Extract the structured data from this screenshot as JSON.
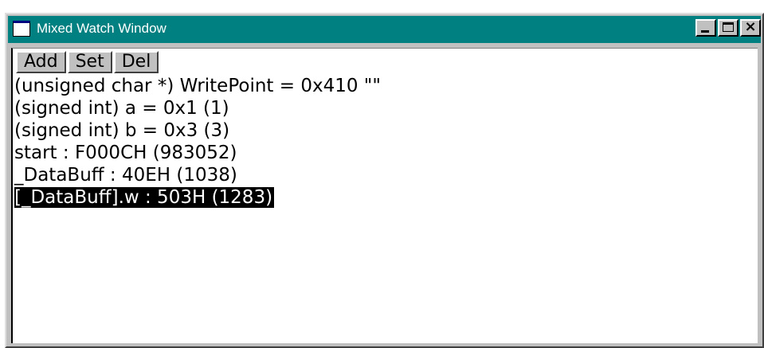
{
  "window": {
    "title": "Mixed Watch Window",
    "title_icon": "app-window-icon",
    "controls": {
      "minimize_icon": "minimize-icon",
      "maximize_icon": "maximize-icon",
      "close_icon": "close-icon",
      "close_glyph": "×"
    },
    "titlebar_color": "#008080"
  },
  "toolbar": {
    "add_label": "Add",
    "set_label": "Set",
    "del_label": "Del"
  },
  "watches": [
    {
      "text": "(unsigned char *) WritePoint = 0x410 \"\"",
      "selected": false
    },
    {
      "text": "(signed int) a = 0x1 (1)",
      "selected": false
    },
    {
      "text": "(signed int) b = 0x3 (3)",
      "selected": false
    },
    {
      "text": "start : F000CH (983052)",
      "selected": false
    },
    {
      "text": "_DataBuff : 40EH (1038)",
      "selected": false
    },
    {
      "text": "[_DataBuff].w : 503H (1283)",
      "selected": true
    }
  ]
}
